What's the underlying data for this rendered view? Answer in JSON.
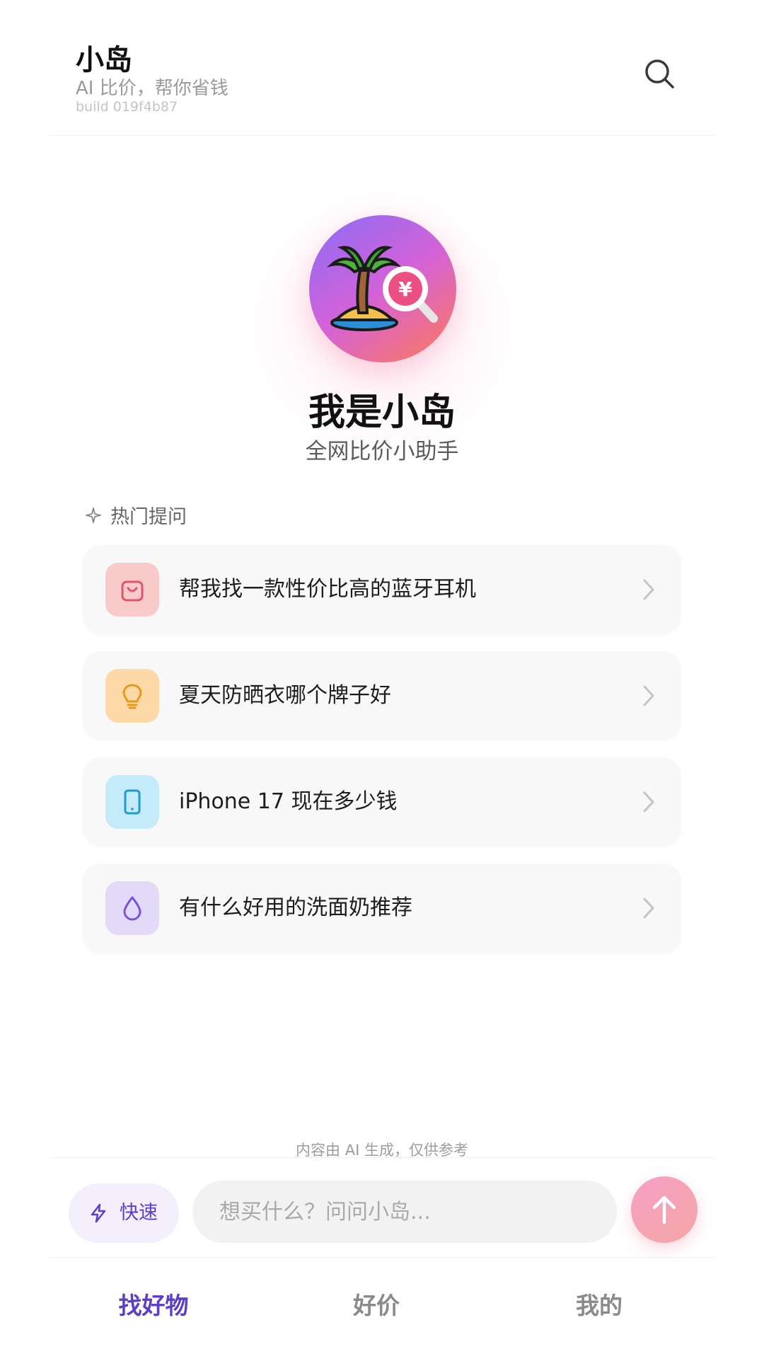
{
  "header": {
    "title": "小岛",
    "subtitle": "AI 比价，帮你省钱",
    "build": "build 019f4b87",
    "search_icon": "search-icon"
  },
  "hero": {
    "logo_icon": "palm-island-yuan-search-icon",
    "title": "我是小岛",
    "subtitle": "全网比价小助手"
  },
  "suggestions": {
    "label": "热门提问",
    "label_icon": "sparkle-icon",
    "items": [
      {
        "label": "帮我找一款性价比高的蓝牙耳机",
        "icon": "shopping-bag-icon",
        "color": "#f5c8c8"
      },
      {
        "label": "夏天防晒衣哪个牌子好",
        "icon": "lightbulb-icon",
        "color": "#fcdcb0"
      },
      {
        "label": "iPhone 17 现在多少钱",
        "icon": "phone-icon",
        "color": "#c6ecf9"
      },
      {
        "label": "有什么好用的洗面奶推荐",
        "icon": "droplet-icon",
        "color": "#e4dcf8"
      }
    ]
  },
  "disclaimer": "内容由 AI 生成，仅供参考",
  "composer": {
    "quick_label": "快速",
    "quick_icon": "lightning-icon",
    "placeholder": "想买什么？问问小岛...",
    "send_icon": "arrow-up-icon"
  },
  "tabs": [
    {
      "label": "找好物",
      "active": true
    },
    {
      "label": "好价",
      "active": false
    },
    {
      "label": "我的",
      "active": false
    }
  ],
  "colors": {
    "accent": "#5b3fc7",
    "send_gradient": [
      "#f6a0c8",
      "#f4a6a2"
    ],
    "logo_gradient": [
      "#8a6cf5",
      "#d462d8",
      "#ff7a55"
    ]
  }
}
